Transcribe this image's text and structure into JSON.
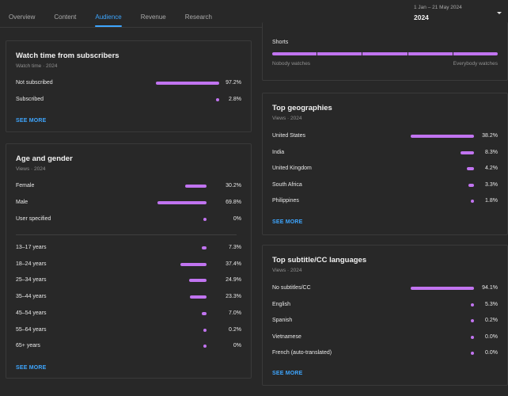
{
  "tabs": [
    {
      "label": "Overview",
      "active": false
    },
    {
      "label": "Content",
      "active": false
    },
    {
      "label": "Audience",
      "active": true
    },
    {
      "label": "Revenue",
      "active": false
    },
    {
      "label": "Research",
      "active": false
    }
  ],
  "date_picker": {
    "range": "1 Jan – 21 May 2024",
    "selected": "2024",
    "icon": "caret-down-icon"
  },
  "colors": {
    "accent": "#3ea6ff",
    "bar": "#c174f0",
    "background": "#282828"
  },
  "cards": {
    "watch_time": {
      "title": "Watch time from subscribers",
      "subtitle": "Watch time · 2024",
      "rows": [
        {
          "label": "Not subscribed",
          "value": "97.2%",
          "pct": 97.2
        },
        {
          "label": "Subscribed",
          "value": "2.8%",
          "pct": 2.8
        }
      ],
      "see_more": "SEE MORE"
    },
    "age_gender": {
      "title": "Age and gender",
      "subtitle": "Views · 2024",
      "gender_rows": [
        {
          "label": "Female",
          "value": "30.2%",
          "pct": 30.2
        },
        {
          "label": "Male",
          "value": "69.8%",
          "pct": 69.8
        },
        {
          "label": "User specified",
          "value": "0%",
          "pct": 0
        }
      ],
      "age_rows": [
        {
          "label": "13–17 years",
          "value": "7.3%",
          "pct": 7.3
        },
        {
          "label": "18–24 years",
          "value": "37.4%",
          "pct": 37.4
        },
        {
          "label": "25–34 years",
          "value": "24.9%",
          "pct": 24.9
        },
        {
          "label": "35–44 years",
          "value": "23.3%",
          "pct": 23.3
        },
        {
          "label": "45–54 years",
          "value": "7.0%",
          "pct": 7.0
        },
        {
          "label": "55–64 years",
          "value": "0.2%",
          "pct": 0.2
        },
        {
          "label": "65+ years",
          "value": "0%",
          "pct": 0
        }
      ],
      "see_more": "SEE MORE"
    },
    "shorts": {
      "label": "Shorts",
      "scale_left": "Nobody watches",
      "scale_right": "Everybody watches"
    },
    "geographies": {
      "title": "Top geographies",
      "subtitle": "Views · 2024",
      "rows": [
        {
          "label": "United States",
          "value": "38.2%",
          "pct": 38.2
        },
        {
          "label": "India",
          "value": "8.3%",
          "pct": 8.3
        },
        {
          "label": "United Kingdom",
          "value": "4.2%",
          "pct": 4.2
        },
        {
          "label": "South Africa",
          "value": "3.3%",
          "pct": 3.3
        },
        {
          "label": "Philippines",
          "value": "1.8%",
          "pct": 1.8
        }
      ],
      "see_more": "SEE MORE"
    },
    "subtitles": {
      "title": "Top subtitle/CC languages",
      "subtitle": "Views · 2024",
      "rows": [
        {
          "label": "No subtitles/CC",
          "value": "94.1%",
          "pct": 94.1
        },
        {
          "label": "English",
          "value": "5.3%",
          "pct": 5.3
        },
        {
          "label": "Spanish",
          "value": "0.2%",
          "pct": 0.2
        },
        {
          "label": "Vietnamese",
          "value": "0.0%",
          "pct": 0.0
        },
        {
          "label": "French (auto-translated)",
          "value": "0.0%",
          "pct": 0.0
        }
      ],
      "see_more": "SEE MORE"
    }
  }
}
